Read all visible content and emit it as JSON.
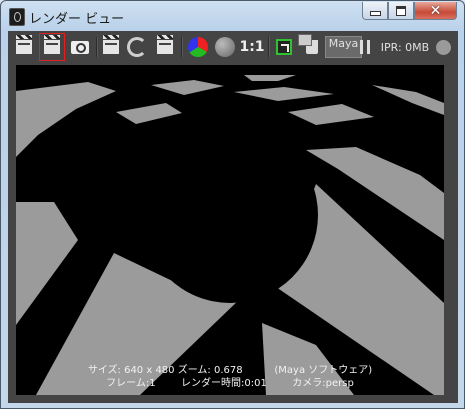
{
  "window": {
    "title": "レンダー ビュー",
    "close_glyph": "✕"
  },
  "toolbar": {
    "one_to_one_label": "1:1",
    "maya_label": "Maya",
    "ipr_label": "IPR: 0MB"
  },
  "render_info": {
    "line1": "サイズ: 640 x 480 ズーム: 0.678          (Maya ソフトウェア)",
    "line2": "フレーム:1        レンダー時間:0:01        カメラ:persp"
  },
  "colors": {
    "background": "#000000",
    "floor_tile": "#9b9b9b",
    "toolbar": "#444444",
    "highlight": "#e02020"
  }
}
